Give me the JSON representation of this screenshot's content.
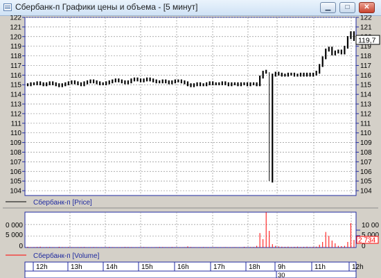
{
  "window": {
    "title": "Сбербанк-п Графики цены и объема - [5 минут]",
    "minimize_glyph": "▁",
    "maximize_glyph": "□",
    "close_glyph": "✕"
  },
  "colors": {
    "frame": "#d4d0c8",
    "axis": "#1f2aa0",
    "price": "#000000",
    "volume": "#ff0000",
    "grid": "#909090"
  },
  "price_panel": {
    "legend": "Сбербанк-п [Price]",
    "last_value_label": "119,7"
  },
  "volume_panel": {
    "legend": "Сбербанк-п [Volume]",
    "left_ticks": [
      "0 000",
      "5 000",
      "0"
    ],
    "right_ticks": [
      "10 00",
      "5 000",
      "0"
    ],
    "last_value_label": "2 734"
  },
  "time_axis": {
    "labels": [
      "12h",
      "13h",
      "14h",
      "15h",
      "16h",
      "17h",
      "18h",
      "9h",
      "11h",
      "12h"
    ],
    "date_label": "30"
  },
  "chart_data": {
    "type": "line",
    "price": {
      "ylim": [
        103.5,
        122
      ],
      "yticks": [
        104,
        105,
        106,
        107,
        108,
        109,
        110,
        111,
        112,
        113,
        114,
        115,
        116,
        117,
        118,
        119,
        120,
        121,
        122
      ],
      "series": [
        {
          "name": "Сбербанк-п [Price]",
          "values": [
            115.0,
            115.1,
            115.1,
            115.2,
            115.1,
            115.0,
            115.1,
            115.2,
            115.1,
            115.0,
            114.9,
            115.0,
            115.1,
            115.2,
            115.3,
            115.2,
            115.1,
            115.0,
            115.2,
            115.3,
            115.4,
            115.3,
            115.2,
            115.1,
            115.1,
            115.2,
            115.3,
            115.4,
            115.5,
            115.4,
            115.3,
            115.2,
            115.3,
            115.5,
            115.6,
            115.5,
            115.4,
            115.5,
            115.6,
            115.5,
            115.4,
            115.3,
            115.3,
            115.4,
            115.3,
            115.2,
            115.3,
            115.4,
            115.4,
            115.3,
            115.2,
            115.0,
            114.9,
            115.0,
            115.1,
            115.0,
            115.0,
            115.1,
            115.2,
            115.1,
            115.1,
            115.1,
            115.2,
            115.1,
            115.0,
            115.1,
            115.1,
            115.0,
            115.1,
            115.1,
            115.0,
            115.1,
            115.1,
            115.0,
            115.8,
            116.3,
            116.4,
            105.0,
            116.0,
            116.2,
            116.1,
            116.0,
            116.0,
            116.1,
            116.1,
            116.0,
            116.0,
            116.1,
            116.0,
            116.1,
            116.0,
            116.1,
            116.3,
            117.0,
            117.8,
            118.6,
            118.8,
            118.2,
            118.4,
            118.5,
            118.3,
            118.9,
            119.9,
            120.4,
            119.7
          ]
        }
      ]
    },
    "volume": {
      "ylim": [
        0,
        12500
      ],
      "series": [
        {
          "name": "Сбербанк-п [Volume]",
          "values": [
            250,
            150,
            180,
            220,
            300,
            150,
            180,
            200,
            150,
            120,
            260,
            180,
            150,
            200,
            150,
            130,
            150,
            180,
            200,
            120,
            150,
            180,
            150,
            120,
            130,
            150,
            200,
            150,
            120,
            130,
            150,
            200,
            180,
            150,
            120,
            130,
            150,
            180,
            150,
            120,
            130,
            150,
            200,
            180,
            150,
            150,
            200,
            150,
            130,
            120,
            150,
            400,
            200,
            150,
            130,
            150,
            180,
            150,
            120,
            130,
            150,
            120,
            130,
            150,
            120,
            130,
            150,
            120,
            130,
            250,
            150,
            180,
            200,
            600,
            5200,
            3000,
            12700,
            6000,
            1200,
            600,
            400,
            300,
            250,
            300,
            200,
            250,
            300,
            200,
            250,
            300,
            200,
            250,
            300,
            1000,
            2000,
            5600,
            4200,
            2500,
            1500,
            600,
            500,
            600,
            2000,
            8800,
            2734
          ]
        }
      ]
    },
    "x_labels": [
      "12h",
      "13h",
      "14h",
      "15h",
      "16h",
      "17h",
      "18h",
      "9h",
      "11h",
      "12h"
    ],
    "grid": true
  }
}
